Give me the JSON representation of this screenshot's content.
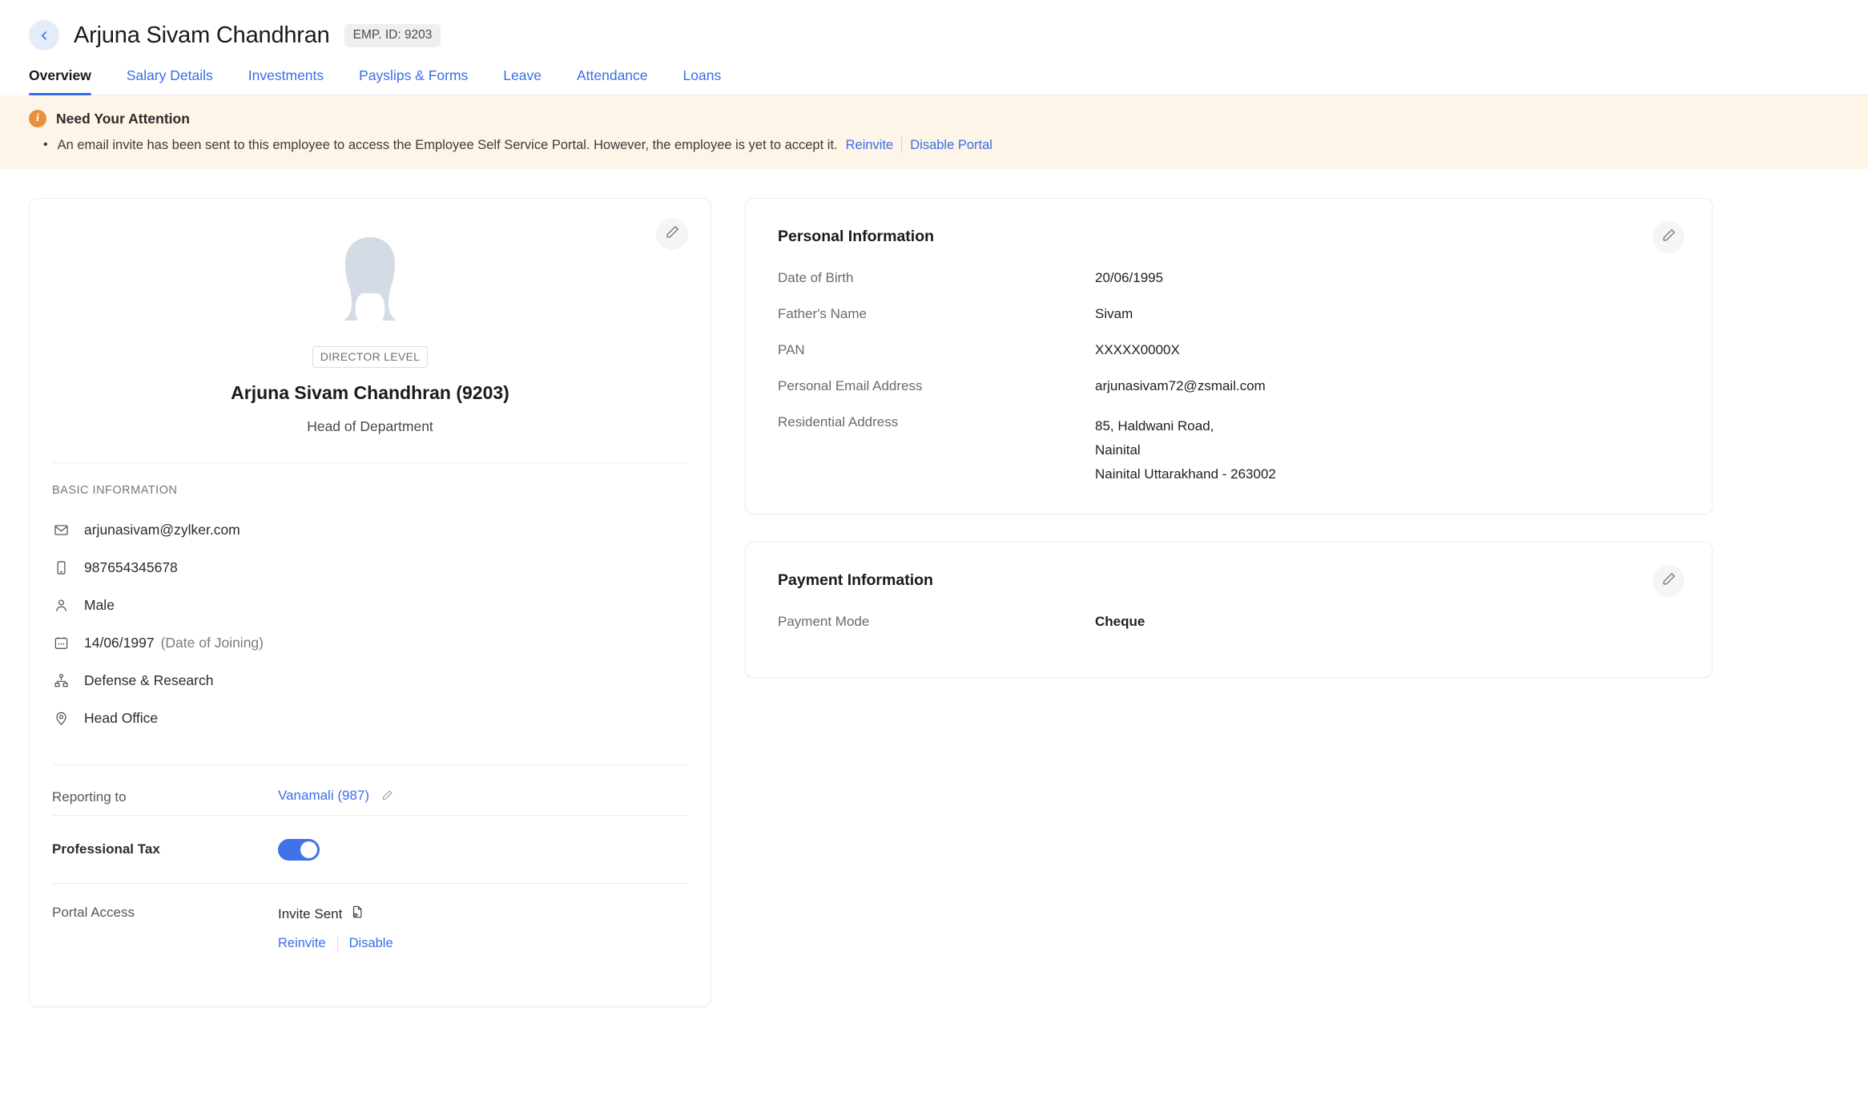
{
  "header": {
    "back_icon": "chevron-left-icon",
    "title": "Arjuna Sivam Chandhran",
    "emp_id_badge": "EMP. ID: 9203"
  },
  "tabs": [
    {
      "label": "Overview",
      "active": true
    },
    {
      "label": "Salary Details",
      "active": false
    },
    {
      "label": "Investments",
      "active": false
    },
    {
      "label": "Payslips & Forms",
      "active": false
    },
    {
      "label": "Leave",
      "active": false
    },
    {
      "label": "Attendance",
      "active": false
    },
    {
      "label": "Loans",
      "active": false
    }
  ],
  "banner": {
    "icon": "info-icon",
    "title": "Need Your Attention",
    "message": "An email invite has been sent to this employee to access the Employee Self Service Portal. However, the employee is yet to accept it.",
    "reinvite_label": "Reinvite",
    "disable_portal_label": "Disable Portal",
    "bg_color": "#fdf5e7",
    "icon_color": "#e8913a"
  },
  "profile": {
    "edit_icon": "pencil-icon",
    "avatar_icon": "user-silhouette-avatar",
    "level_badge": "DIRECTOR LEVEL",
    "name": "Arjuna Sivam Chandhran (9203)",
    "role": "Head of Department",
    "basic_info_label": "BASIC INFORMATION",
    "basic_info": [
      {
        "icon": "envelope-icon",
        "value": "arjunasivam@zylker.com",
        "note": ""
      },
      {
        "icon": "mobile-phone-icon",
        "value": "987654345678",
        "note": ""
      },
      {
        "icon": "person-icon",
        "value": "Male",
        "note": ""
      },
      {
        "icon": "calendar-icon",
        "value": "14/06/1997",
        "note": "(Date of Joining)"
      },
      {
        "icon": "org-chart-icon",
        "value": "Defense & Research",
        "note": ""
      },
      {
        "icon": "location-pin-icon",
        "value": "Head Office",
        "note": ""
      }
    ],
    "reporting_to_label": "Reporting to",
    "reporting_to_value": "Vanamali (987)",
    "professional_tax_label": "Professional Tax",
    "professional_tax_enabled": true,
    "portal_access_label": "Portal Access",
    "portal_status": "Invite Sent",
    "portal_status_icon": "document-preview-icon",
    "portal_reinvite": "Reinvite",
    "portal_disable": "Disable"
  },
  "personal_information": {
    "title": "Personal Information",
    "edit_icon": "pencil-icon",
    "rows": [
      {
        "label": "Date of Birth",
        "value": "20/06/1995"
      },
      {
        "label": "Father's Name",
        "value": "Sivam"
      },
      {
        "label": "PAN",
        "value": "XXXXX0000X"
      },
      {
        "label": "Personal Email Address",
        "value": "arjunasivam72@zsmail.com"
      }
    ],
    "address_label": "Residential Address",
    "address_lines": [
      "85, Haldwani Road,",
      "Nainital",
      "Nainital  Uttarakhand - 263002"
    ]
  },
  "payment_information": {
    "title": "Payment Information",
    "edit_icon": "pencil-icon",
    "payment_mode_label": "Payment Mode",
    "payment_mode_value": "Cheque"
  },
  "colors": {
    "accent_blue": "#3a6ee8",
    "toggle_blue": "#4272e8",
    "banner_bg": "#fdf5e7",
    "banner_icon": "#e8913a"
  }
}
